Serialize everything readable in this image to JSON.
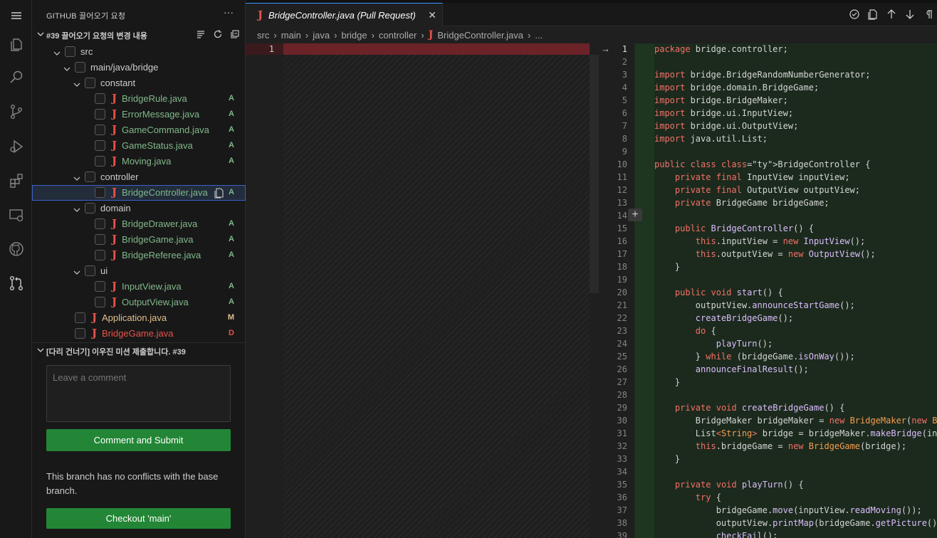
{
  "sidebar": {
    "title": "GITHUB 끌어오기 요청",
    "more": "···",
    "changes_header": "#39 끌어오기 요청의 변경 내용",
    "tree": [
      {
        "label": "src",
        "kind": "folder",
        "status": ""
      },
      {
        "label": "main/java/bridge",
        "kind": "folder",
        "status": ""
      },
      {
        "label": "constant",
        "kind": "folder",
        "status": ""
      },
      {
        "label": "BridgeRule.java",
        "kind": "file",
        "status": "A"
      },
      {
        "label": "ErrorMessage.java",
        "kind": "file",
        "status": "A"
      },
      {
        "label": "GameCommand.java",
        "kind": "file",
        "status": "A"
      },
      {
        "label": "GameStatus.java",
        "kind": "file",
        "status": "A"
      },
      {
        "label": "Moving.java",
        "kind": "file",
        "status": "A"
      },
      {
        "label": "controller",
        "kind": "folder",
        "status": ""
      },
      {
        "label": "BridgeController.java",
        "kind": "file",
        "status": "A"
      },
      {
        "label": "domain",
        "kind": "folder",
        "status": ""
      },
      {
        "label": "BridgeDrawer.java",
        "kind": "file",
        "status": "A"
      },
      {
        "label": "BridgeGame.java",
        "kind": "file",
        "status": "A"
      },
      {
        "label": "BridgeReferee.java",
        "kind": "file",
        "status": "A"
      },
      {
        "label": "ui",
        "kind": "folder",
        "status": ""
      },
      {
        "label": "InputView.java",
        "kind": "file",
        "status": "A"
      },
      {
        "label": "OutputView.java",
        "kind": "file",
        "status": "A"
      },
      {
        "label": "Application.java",
        "kind": "file",
        "status": "M"
      },
      {
        "label": "BridgeGame.java",
        "kind": "file",
        "status": "D"
      }
    ],
    "pr_header": "[다리 건너기] 이우진 미션 제출합니다. #39",
    "comment_placeholder": "Leave a comment",
    "comment_button": "Comment and Submit",
    "no_conflicts": "This branch has no conflicts with the base branch.",
    "checkout_button": "Checkout 'main'"
  },
  "tab": {
    "icon": "J",
    "title": "BridgeController.java (Pull Request)",
    "close": "✕"
  },
  "breadcrumb": [
    "src",
    "main",
    "java",
    "bridge",
    "controller",
    "BridgeController.java",
    "..."
  ],
  "left_editor": {
    "line": "1"
  },
  "code_lines": [
    "package bridge.controller;",
    "",
    "import bridge.BridgeRandomNumberGenerator;",
    "import bridge.domain.BridgeGame;",
    "import bridge.BridgeMaker;",
    "import bridge.ui.InputView;",
    "import bridge.ui.OutputView;",
    "import java.util.List;",
    "",
    "public class BridgeController {",
    "    private final InputView inputView;",
    "    private final OutputView outputView;",
    "    private BridgeGame bridgeGame;",
    "",
    "    public BridgeController() {",
    "        this.inputView = new InputView();",
    "        this.outputView = new OutputView();",
    "    }",
    "",
    "    public void start() {",
    "        outputView.announceStartGame();",
    "        createBridgeGame();",
    "        do {",
    "            playTurn();",
    "        } while (bridgeGame.isOnWay());",
    "        announceFinalResult();",
    "    }",
    "",
    "    private void createBridgeGame() {",
    "        BridgeMaker bridgeMaker = new BridgeMaker(new B",
    "        List<String> bridge = bridgeMaker.makeBridge(in",
    "        this.bridgeGame = new BridgeGame(bridge);",
    "    }",
    "",
    "    private void playTurn() {",
    "        try {",
    "            bridgeGame.move(inputView.readMoving());",
    "            outputView.printMap(bridgeGame.getPicture()",
    "            checkFail();"
  ],
  "colors": {
    "added": "#81b88b",
    "modified": "#e2c08d",
    "deleted": "#e5534b",
    "button": "#238636",
    "accent": "#3794ff"
  }
}
